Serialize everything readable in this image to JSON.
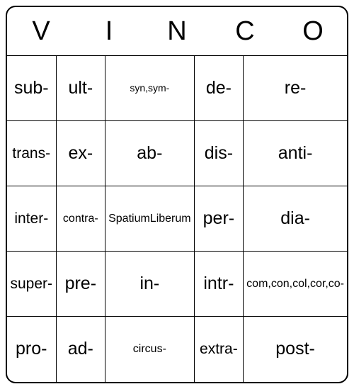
{
  "header": [
    "V",
    "I",
    "N",
    "C",
    "O"
  ],
  "grid": [
    [
      {
        "text": "sub-",
        "size": "large"
      },
      {
        "text": "ult-",
        "size": "large"
      },
      {
        "text": "syn,sym-",
        "size": "xsmall"
      },
      {
        "text": "de-",
        "size": "large"
      },
      {
        "text": "re-",
        "size": "large"
      }
    ],
    [
      {
        "text": "trans-",
        "size": "med"
      },
      {
        "text": "ex-",
        "size": "large"
      },
      {
        "text": "ab-",
        "size": "large"
      },
      {
        "text": "dis-",
        "size": "large"
      },
      {
        "text": "anti-",
        "size": "large"
      }
    ],
    [
      {
        "text": "inter-",
        "size": "med"
      },
      {
        "text": "contra-",
        "size": "small"
      },
      {
        "lines": [
          "Spatium",
          "Liberum"
        ],
        "size": "free-top"
      },
      {
        "text": "per-",
        "size": "large"
      },
      {
        "text": "dia-",
        "size": "large"
      }
    ],
    [
      {
        "text": "super-",
        "size": "med"
      },
      {
        "text": "pre-",
        "size": "large"
      },
      {
        "text": "in-",
        "size": "large"
      },
      {
        "text": "intr-",
        "size": "large"
      },
      {
        "lines": [
          "com,",
          "con,col,",
          "cor,co-"
        ],
        "size": "small"
      }
    ],
    [
      {
        "text": "pro-",
        "size": "large"
      },
      {
        "text": "ad-",
        "size": "large"
      },
      {
        "text": "circus-",
        "size": "small"
      },
      {
        "text": "extra-",
        "size": "med"
      },
      {
        "text": "post-",
        "size": "large"
      }
    ]
  ]
}
